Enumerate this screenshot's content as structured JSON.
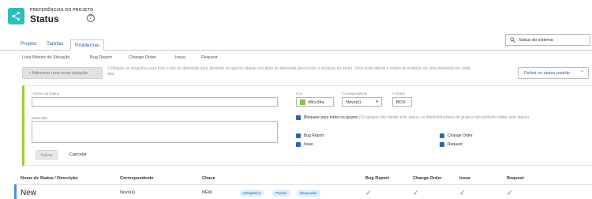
{
  "header": {
    "crumb": "PREFERÊNCIAS DO PROJETO",
    "title": "Status",
    "help": "?"
  },
  "tabs": [
    {
      "label": "Projeto"
    },
    {
      "label": "Tarefas"
    },
    {
      "label": "Problemas"
    }
  ],
  "search": {
    "value": "Status do sistema"
  },
  "subnav": {
    "master": "Lista Mestre de Situação",
    "items": [
      "Bug Report",
      "Change Order",
      "Issue",
      "Request"
    ]
  },
  "toolbar": {
    "add_label": "+ Adicionar uma nova situação",
    "description": "Configure as situações para todo o tipo de demanda aqui. Assinale as opções abaixo dos tipos de demanda para incluir a situação no menu. Você pode alterar a ordem de exibição de uma demanda em cada aba.",
    "default_status_label": "Definir os status padrão",
    "default_status_chevron": "⌄"
  },
  "form": {
    "name_label": "• Nome do Status",
    "name_value": "",
    "description_label": "Descrição",
    "description_value": "",
    "color_label": "Cor",
    "color_value": "#8cc34a",
    "color_hex": "#8cc34a",
    "match_label": "Correspondente",
    "match_value": "Novo(s)",
    "key_label": "• Chave",
    "key_value": "BOX",
    "lock_label": "Bloquear para todos os grupos",
    "lock_hint": "(Os grupos não herdar este status, os Administradores de grupos não poderão editar este status)",
    "types": [
      "Bug Report",
      "Issue",
      "Change Order",
      "Request"
    ],
    "save_label": "Salvar",
    "cancel_label": "Cancelar"
  },
  "table": {
    "columns": [
      "Nome de Status / Descrição",
      "Correspondente",
      "Chave",
      "Bug Report",
      "Change Order",
      "Issue",
      "Request"
    ],
    "rows": [
      {
        "name": "New",
        "match": "Novo(s)",
        "key": "NEW",
        "badges": [
          "Obrigatório",
          "Padrão",
          "Bloqueado"
        ],
        "check": "✓"
      }
    ]
  },
  "colors": {
    "accent": "#2cbfbf",
    "link": "#2a67b1",
    "form_border": "#9cce34",
    "row_border": "#4e8ee0"
  }
}
